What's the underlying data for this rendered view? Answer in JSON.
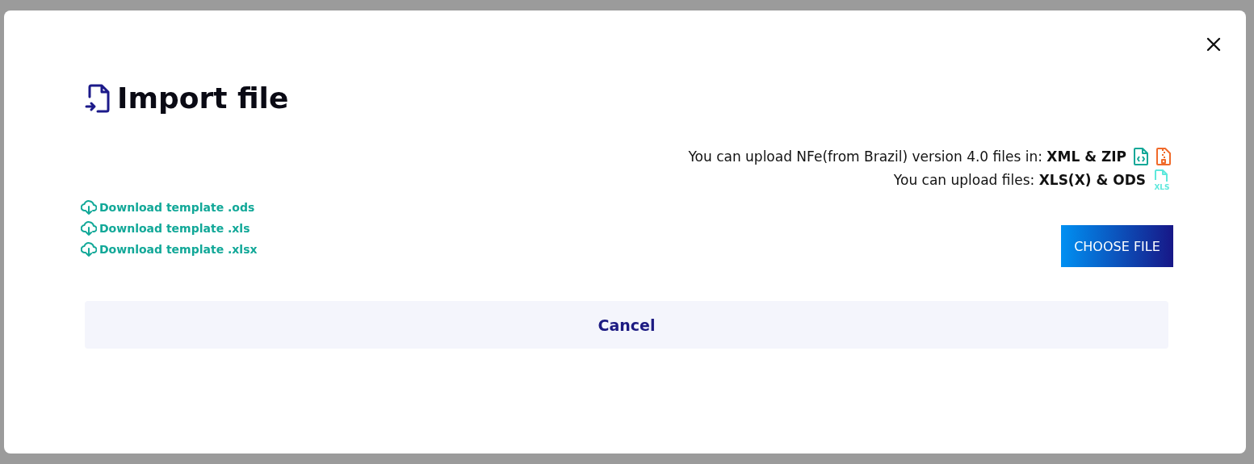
{
  "dialog": {
    "title": "Import file",
    "upload_info": [
      {
        "text": "You can upload NFe(from Brazil) version 4.0 files in: **XML & ZIP**",
        "icons": [
          {
            "kind": "code"
          },
          {
            "kind": "zip"
          }
        ]
      },
      {
        "text": "You can upload files: **XLS(X) & ODS**",
        "icons": [
          {
            "kind": "sheet",
            "label": "XLS"
          }
        ]
      }
    ],
    "template_links": [
      "Download template .ods",
      "Download template .xls",
      "Download template .xlsx"
    ],
    "choose_button": "CHOOSE FILE",
    "cancel_button": "Cancel"
  }
}
